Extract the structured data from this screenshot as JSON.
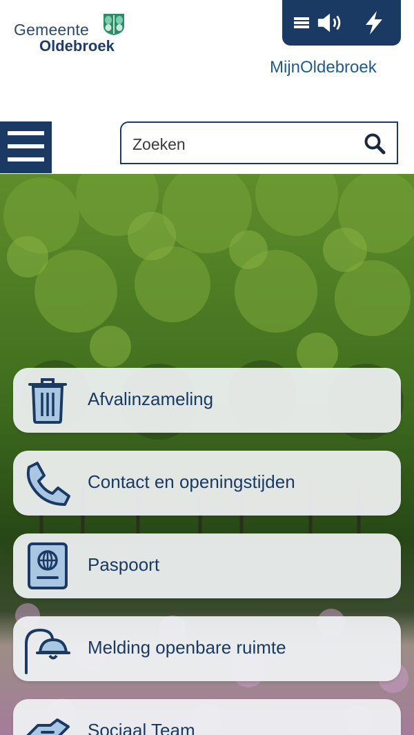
{
  "header": {
    "logo": {
      "line1": "Gemeente",
      "line2": "Oldebroek"
    },
    "toolbar": [
      {
        "name": "menu-list-icon"
      },
      {
        "name": "speaker-icon"
      },
      {
        "name": "lightning-icon"
      }
    ],
    "mijn_link": "MijnOldebroek",
    "search": {
      "placeholder": "Zoeken",
      "value": ""
    }
  },
  "tiles": [
    {
      "label": "Afvalinzameling",
      "icon": "trash-bin-icon"
    },
    {
      "label": "Contact en openingstijden",
      "icon": "phone-icon"
    },
    {
      "label": "Paspoort",
      "icon": "passport-icon"
    },
    {
      "label": "Melding openbare ruimte",
      "icon": "street-lamp-icon"
    },
    {
      "label": "Sociaal Team",
      "icon": "handshake-icon"
    }
  ],
  "colors": {
    "brand_navy": "#1a3a63",
    "link_blue": "#1e5b8c",
    "tile_bg": "#f0f2f4",
    "logo_green": "#2e8b6a"
  }
}
